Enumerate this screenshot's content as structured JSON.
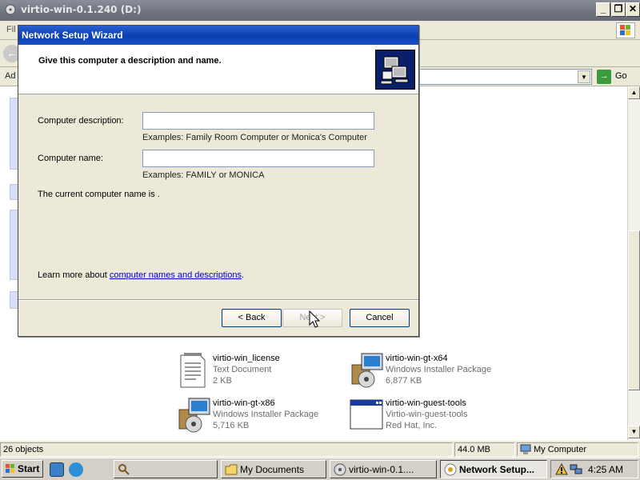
{
  "explorer": {
    "title": "virtio-win-0.1.240 (D:)",
    "menu_partial": "Fil",
    "address_label": "Ad",
    "go_label": "Go",
    "files": [
      {
        "name": "virtio-win_license",
        "type": "Text Document",
        "size": "2 KB",
        "icon": "text-document-icon"
      },
      {
        "name": "virtio-win-gt-x64",
        "type": "Windows Installer Package",
        "size": "6,877 KB",
        "icon": "installer-package-icon"
      },
      {
        "name": "virtio-win-gt-x86",
        "type": "Windows Installer Package",
        "size": "5,716 KB",
        "icon": "installer-package-icon"
      },
      {
        "name": "virtio-win-guest-tools",
        "type": "Virtio-win-guest-tools",
        "size": "Red Hat, Inc.",
        "icon": "application-window-icon"
      }
    ],
    "status": {
      "objects": "26 objects",
      "size": "44.0 MB",
      "location": "My Computer"
    }
  },
  "dialog": {
    "title": "Network Setup Wizard",
    "header": "Give this computer a description and name.",
    "description_label": "Computer description:",
    "description_value": "",
    "description_hint": "Examples: Family Room Computer or Monica's Computer",
    "name_label": "Computer name:",
    "name_value": "",
    "name_hint": "Examples: FAMILY or MONICA",
    "current_name_text": "The current computer name is .",
    "learn_more_prefix": "Learn more about ",
    "learn_more_link": "computer names and descriptions",
    "learn_more_suffix": ".",
    "back_label": "< Back",
    "next_label": "Next >",
    "cancel_label": "Cancel"
  },
  "taskbar": {
    "start_label": "Start",
    "tasks": [
      {
        "label": "",
        "icon": "search-icon"
      },
      {
        "label": "My Documents",
        "icon": "folder-icon"
      },
      {
        "label": "virtio-win-0.1....",
        "icon": "cd-drive-icon"
      },
      {
        "label": "Network Setup...",
        "icon": "network-wizard-icon",
        "active": true
      }
    ],
    "clock": "4:25 AM"
  },
  "colors": {
    "dialog_title_bar": "#0a3fb0",
    "inactive_title_bar": "#6e737e",
    "link": "#0000c8",
    "window_face": "#ece9d8"
  }
}
